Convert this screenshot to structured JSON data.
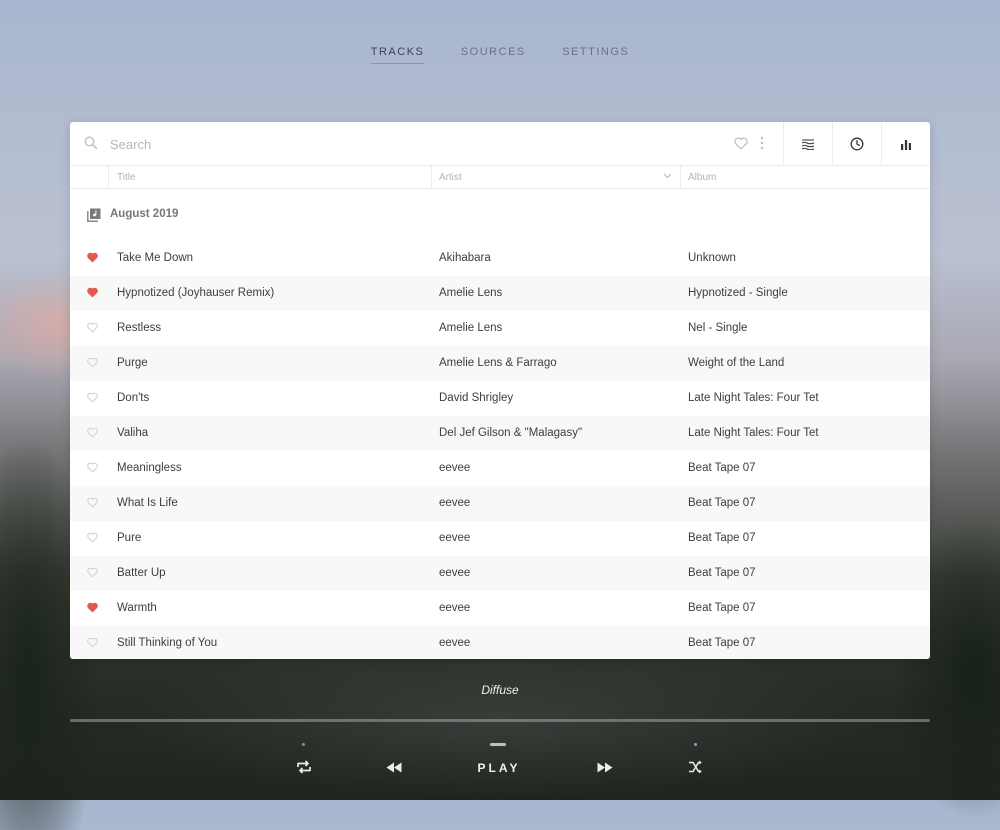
{
  "nav": {
    "tabs": [
      {
        "label": "TRACKS",
        "active": true
      },
      {
        "label": "SOURCES",
        "active": false
      },
      {
        "label": "SETTINGS",
        "active": false
      }
    ]
  },
  "search": {
    "placeholder": "Search",
    "value": ""
  },
  "columns": {
    "title": "Title",
    "artist": "Artist",
    "album": "Album"
  },
  "group": {
    "label": "August 2019"
  },
  "tracks": [
    {
      "title": "Take Me Down",
      "artist": "Akihabara",
      "album": "Unknown",
      "favorite": true
    },
    {
      "title": "Hypnotized (Joyhauser Remix)",
      "artist": "Amelie Lens",
      "album": "Hypnotized - Single",
      "favorite": true
    },
    {
      "title": "Restless",
      "artist": "Amelie Lens",
      "album": "Nel - Single",
      "favorite": false
    },
    {
      "title": "Purge",
      "artist": "Amelie Lens & Farrago",
      "album": "Weight of the Land",
      "favorite": false
    },
    {
      "title": "Don'ts",
      "artist": "David Shrigley",
      "album": "Late Night Tales: Four Tet",
      "favorite": false
    },
    {
      "title": "Valiha",
      "artist": "Del Jef Gilson & \"Malagasy\"",
      "album": "Late Night Tales: Four Tet",
      "favorite": false
    },
    {
      "title": "Meaningless",
      "artist": "eevee",
      "album": "Beat Tape 07",
      "favorite": false
    },
    {
      "title": "What Is Life",
      "artist": "eevee",
      "album": "Beat Tape 07",
      "favorite": false
    },
    {
      "title": "Pure",
      "artist": "eevee",
      "album": "Beat Tape 07",
      "favorite": false
    },
    {
      "title": "Batter Up",
      "artist": "eevee",
      "album": "Beat Tape 07",
      "favorite": false
    },
    {
      "title": "Warmth",
      "artist": "eevee",
      "album": "Beat Tape 07",
      "favorite": true
    },
    {
      "title": "Still Thinking of You",
      "artist": "eevee",
      "album": "Beat Tape 07",
      "favorite": false
    }
  ],
  "player": {
    "now_playing": "Diffuse",
    "play_label": "PLAY"
  },
  "colors": {
    "favorite": "#e05a4f",
    "heart_outline": "#cfcfcf",
    "shuffle_dot": "#7aa6d8"
  },
  "icons": {
    "search": "search-icon",
    "heart": "heart-icon",
    "more": "more-vertical-icon",
    "waves": "waves-icon",
    "clock": "clock-icon",
    "chart": "bar-chart-icon",
    "chevron": "chevron-down-icon",
    "album": "album-stack-icon",
    "repeat": "repeat-icon",
    "rewind": "rewind-icon",
    "forward": "fast-forward-icon",
    "shuffle": "shuffle-icon"
  }
}
